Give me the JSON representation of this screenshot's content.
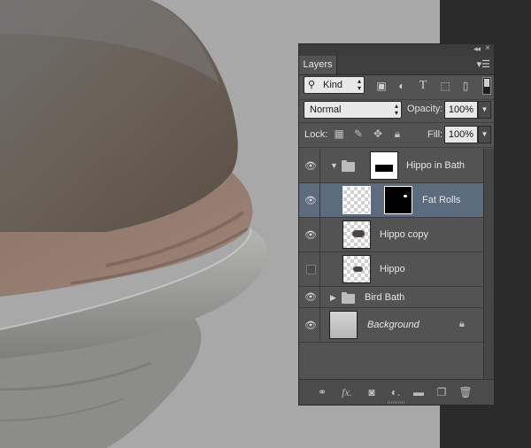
{
  "panel": {
    "tab": "Layers",
    "filter_kind": "Kind",
    "blend_mode": "Normal",
    "opacity_label": "Opacity:",
    "opacity_value": "100%",
    "lock_label": "Lock:",
    "fill_label": "Fill:",
    "fill_value": "100%"
  },
  "layers": [
    {
      "name": "Hippo in Bath",
      "type": "group",
      "visible": true,
      "expanded": true
    },
    {
      "name": "Fat Rolls",
      "type": "layer-with-mask",
      "visible": true,
      "selected": true
    },
    {
      "name": "Hippo copy",
      "type": "layer",
      "visible": true
    },
    {
      "name": "Hippo",
      "type": "layer",
      "visible": false
    },
    {
      "name": "Bird Bath",
      "type": "group",
      "visible": true,
      "expanded": false
    },
    {
      "name": "Background",
      "type": "background",
      "visible": true,
      "locked": true
    }
  ],
  "icons": {
    "filter": [
      "image-filter-icon",
      "adjustment-filter-icon",
      "type-filter-icon",
      "shape-filter-icon",
      "smart-object-filter-icon"
    ],
    "lock": [
      "lock-transparent-icon",
      "lock-image-icon",
      "lock-position-icon",
      "lock-all-icon"
    ],
    "bottom": [
      "link-layers-icon",
      "layer-style-icon",
      "add-mask-icon",
      "adjustment-layer-icon",
      "new-group-icon",
      "new-layer-icon",
      "delete-layer-icon"
    ]
  },
  "colors": {
    "panel_bg": "#535353",
    "selected_row": "#5c6b7e",
    "canvas_bg": "#a8a8a8"
  }
}
